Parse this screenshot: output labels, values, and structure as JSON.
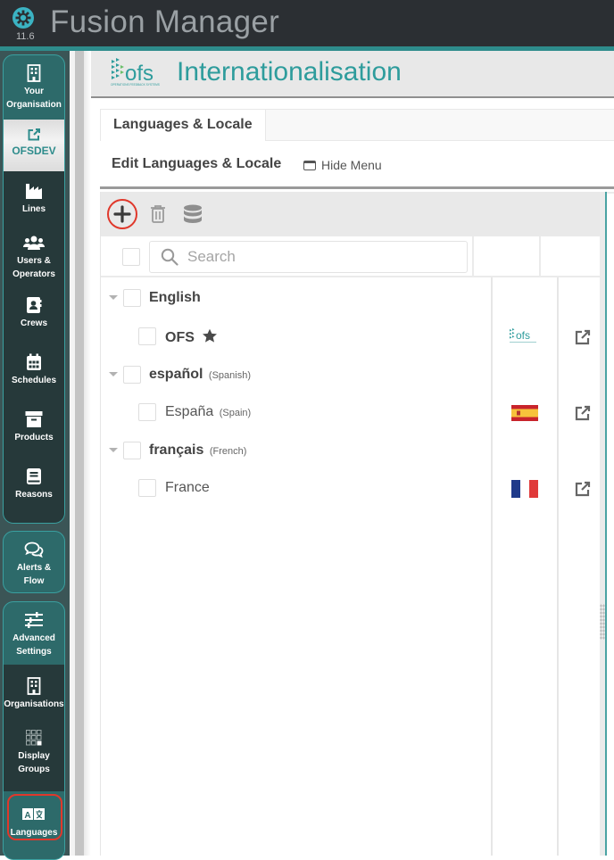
{
  "app": {
    "title": "Fusion Manager",
    "version": "11.6",
    "accent_color": "#2e8c8c",
    "logo_icon": "gear-icon"
  },
  "sidebar": {
    "groups": [
      {
        "items": [
          {
            "label_line1": "Your",
            "label_line2": "Organisation",
            "icon": "building-icon",
            "state": "group-header"
          },
          {
            "label_line1": "OFSDEV",
            "label_line2": "",
            "icon": "external-edit-icon",
            "state": "active"
          },
          {
            "label_line1": "Lines",
            "label_line2": "",
            "icon": "factory-icon",
            "state": "normal"
          },
          {
            "label_line1": "Users &",
            "label_line2": "Operators",
            "icon": "users-icon",
            "state": "normal"
          },
          {
            "label_line1": "Crews",
            "label_line2": "",
            "icon": "address-book-icon",
            "state": "normal"
          },
          {
            "label_line1": "Schedules",
            "label_line2": "",
            "icon": "calendar-icon",
            "state": "normal"
          },
          {
            "label_line1": "Products",
            "label_line2": "",
            "icon": "archive-box-icon",
            "state": "normal"
          },
          {
            "label_line1": "Reasons",
            "label_line2": "",
            "icon": "book-icon",
            "state": "normal"
          }
        ]
      },
      {
        "items": [
          {
            "label_line1": "Alerts &",
            "label_line2": "Flow",
            "icon": "chat-bubbles-icon",
            "state": "group-header"
          }
        ]
      },
      {
        "items": [
          {
            "label_line1": "Advanced",
            "label_line2": "Settings",
            "icon": "sliders-icon",
            "state": "group-header"
          },
          {
            "label_line1": "Organisations",
            "label_line2": "",
            "icon": "building-icon",
            "state": "normal"
          },
          {
            "label_line1": "Display",
            "label_line2": "Groups",
            "icon": "grid-icon",
            "state": "normal"
          },
          {
            "label_line1": "Languages",
            "label_line2": "",
            "icon": "translate-icon",
            "state": "selected-highlighted"
          }
        ]
      }
    ]
  },
  "header": {
    "brand": "ofs",
    "brand_tagline": "OPERATIONS FEEDBACK SYSTEMS",
    "title": "Internationalisation"
  },
  "tabs": [
    {
      "label": "Languages & Locale",
      "active": true
    }
  ],
  "section": {
    "title": "Edit Languages & Locale",
    "hide_menu_label": "Hide Menu"
  },
  "toolbar": {
    "add_label": "Add",
    "delete_label": "Delete",
    "database_label": "Database"
  },
  "search": {
    "placeholder": "Search",
    "value": ""
  },
  "tree": [
    {
      "type": "language",
      "name": "English",
      "native_suffix": "",
      "expanded": true,
      "checked": false
    },
    {
      "type": "locale",
      "name": "OFS",
      "suffix": "",
      "bold": true,
      "default": true,
      "flag": "ofs-logo",
      "checked": false
    },
    {
      "type": "language",
      "name": "español",
      "native_suffix": "(Spanish)",
      "expanded": true,
      "checked": false
    },
    {
      "type": "locale",
      "name": "España",
      "suffix": "(Spain)",
      "bold": false,
      "default": false,
      "flag": "spain-flag",
      "checked": false
    },
    {
      "type": "language",
      "name": "français",
      "native_suffix": "(French)",
      "expanded": true,
      "checked": false
    },
    {
      "type": "locale",
      "name": "France",
      "suffix": "",
      "bold": false,
      "default": false,
      "flag": "france-flag",
      "checked": false
    }
  ]
}
